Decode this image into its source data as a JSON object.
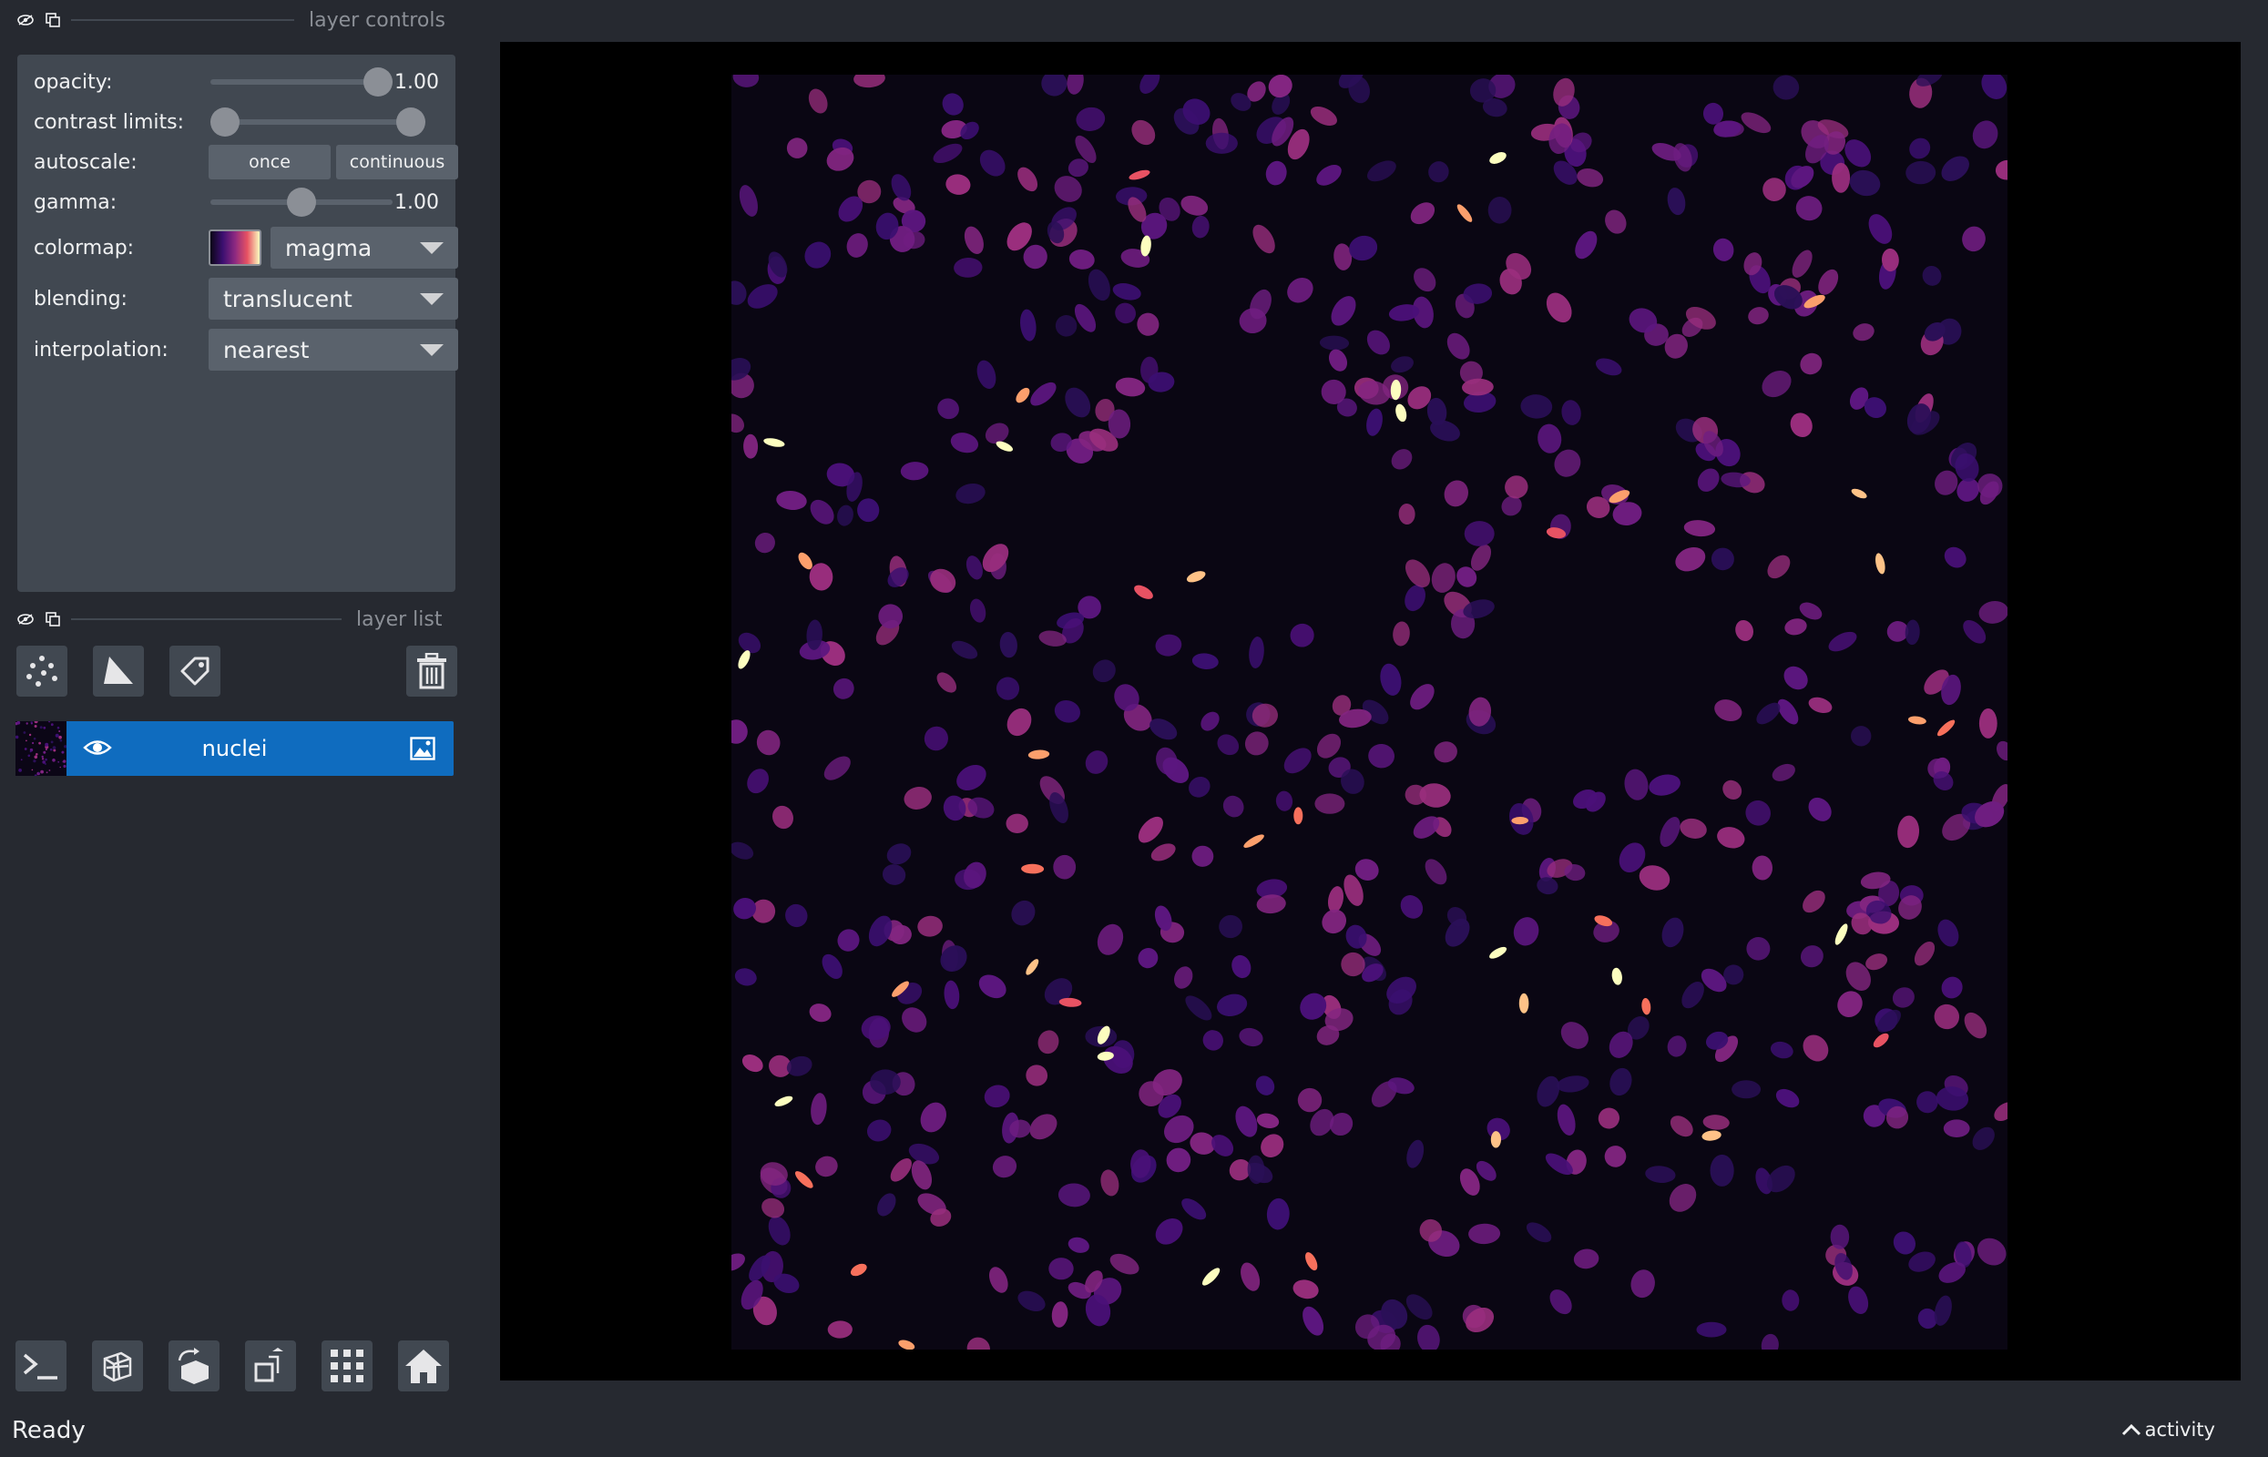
{
  "layer_controls": {
    "title": "layer controls",
    "opacity": {
      "label": "opacity:",
      "value": "1.00",
      "level": 1.0
    },
    "contrast_limits": {
      "label": "contrast limits:",
      "low": 0.0,
      "high": 1.0
    },
    "autoscale": {
      "label": "autoscale:",
      "once": "once",
      "continuous": "continuous"
    },
    "gamma": {
      "label": "gamma:",
      "value": "1.00",
      "level": 0.5
    },
    "colormap": {
      "label": "colormap:",
      "value": "magma"
    },
    "blending": {
      "label": "blending:",
      "value": "translucent"
    },
    "interpolation": {
      "label": "interpolation:",
      "value": "nearest"
    }
  },
  "layer_list": {
    "title": "layer list",
    "layers": [
      {
        "name": "nuclei",
        "visible": true
      }
    ]
  },
  "status": {
    "text": "Ready"
  },
  "activity": {
    "label": "activity"
  },
  "colors": {
    "background": "#262930",
    "panel": "#414851",
    "selected_layer": "#0f6cbf",
    "magma_dark": "#0b0616",
    "magma_mid": "#8c2981",
    "magma_bright": "#fcfdbf"
  },
  "icons": {
    "header": [
      "eye-icon",
      "copy-icon"
    ],
    "layer_tools": [
      "new-points-icon",
      "new-shapes-icon",
      "new-labels-icon",
      "delete-layer-icon"
    ],
    "viewer_buttons": [
      "console-icon",
      "ndisplay-icon",
      "roll-icon",
      "transpose-icon",
      "grid-icon",
      "home-icon"
    ]
  }
}
